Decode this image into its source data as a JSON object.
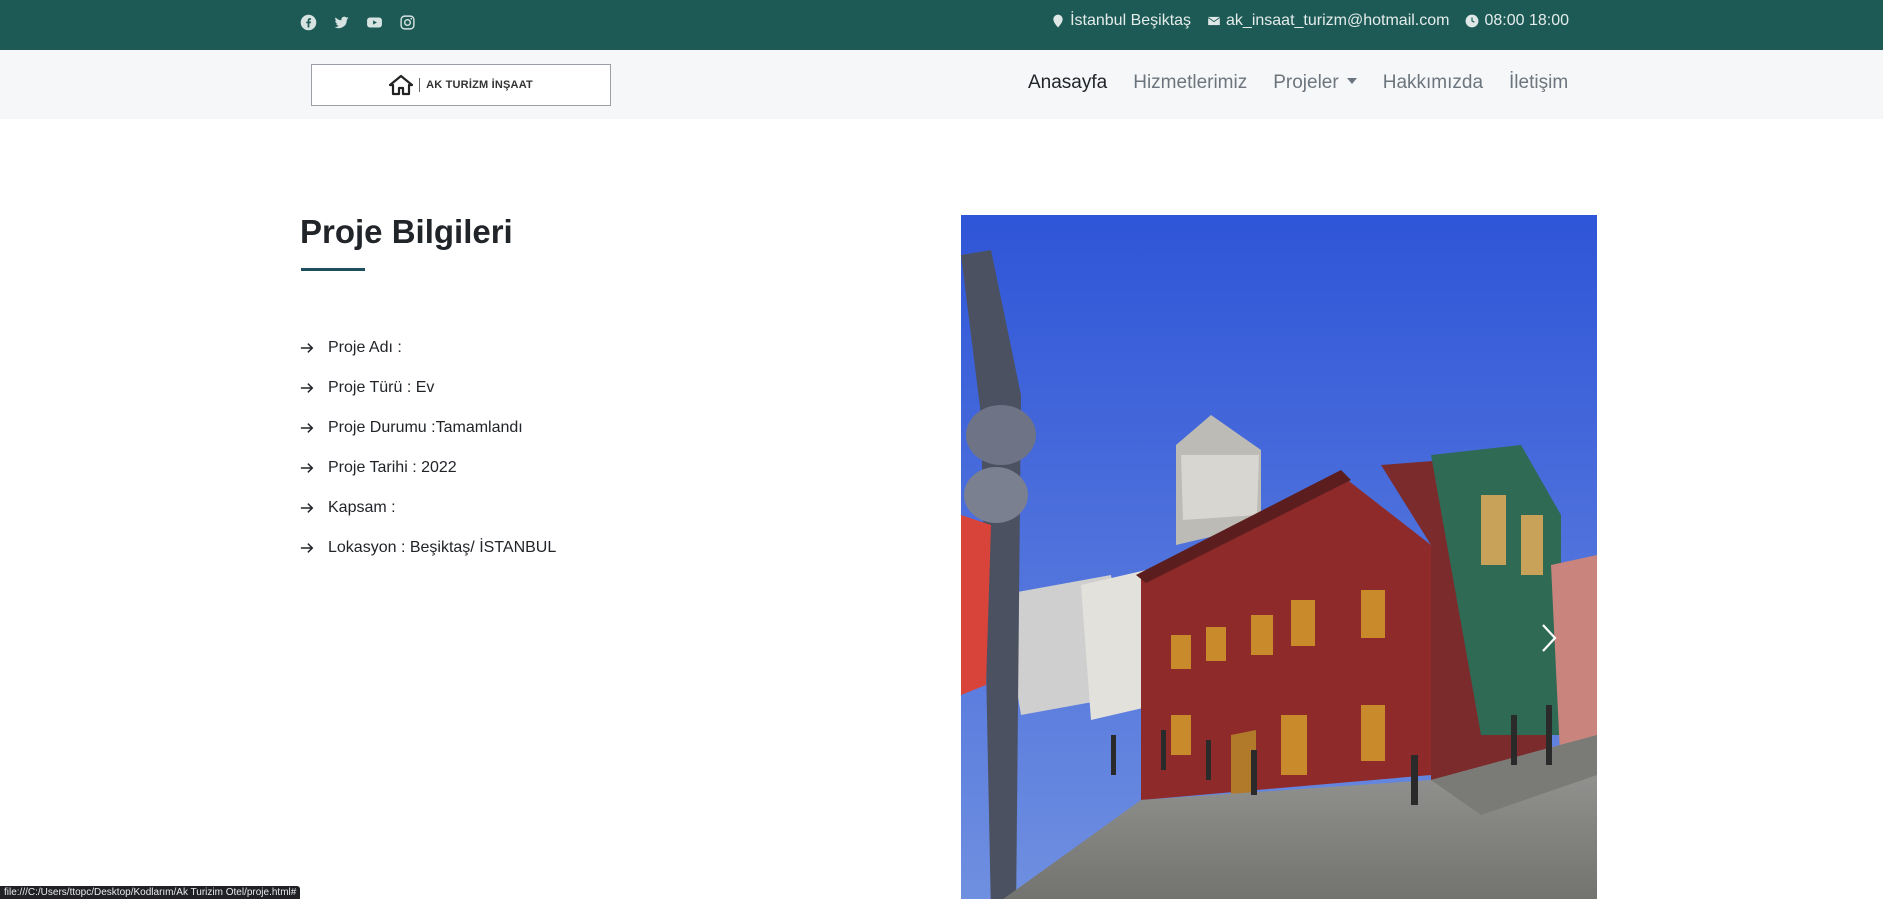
{
  "topbar": {
    "social": [
      "facebook-icon",
      "twitter-icon",
      "youtube-icon",
      "instagram-icon"
    ],
    "location": "İstanbul Beşiktaş",
    "email": "ak_insaat_turizm@hotmail.com",
    "hours": "08:00 18:00"
  },
  "logo": {
    "text": "AK TURİZM İNŞAAT"
  },
  "nav": {
    "items": [
      {
        "label": "Anasayfa",
        "active": true
      },
      {
        "label": "Hizmetlerimiz"
      },
      {
        "label": "Projeler",
        "dropdown": true
      },
      {
        "label": "Hakkımızda"
      },
      {
        "label": "İletişim"
      }
    ]
  },
  "project": {
    "title": "Proje Bilgileri",
    "details": [
      "Proje Adı :",
      "Proje Türü : Ev",
      "Proje Durumu :Tamamlandı",
      "Proje Tarihi : 2022",
      "Kapsam :",
      "Lokasyon : Beşiktaş/ İSTANBUL"
    ]
  },
  "carousel": {
    "image": "street-photo",
    "next_icon": "chevron-right-icon"
  },
  "status_bar": "file:///C:/Users/ttopc/Desktop/Kodlarım/Ak Turizim Otel/proje.html#",
  "colors": {
    "topbar": "#1d5a56",
    "navbar": "#f6f7f9",
    "accent_line": "#1d4f5c",
    "sky": "#3f61d4",
    "house": "#8e2a2a"
  }
}
